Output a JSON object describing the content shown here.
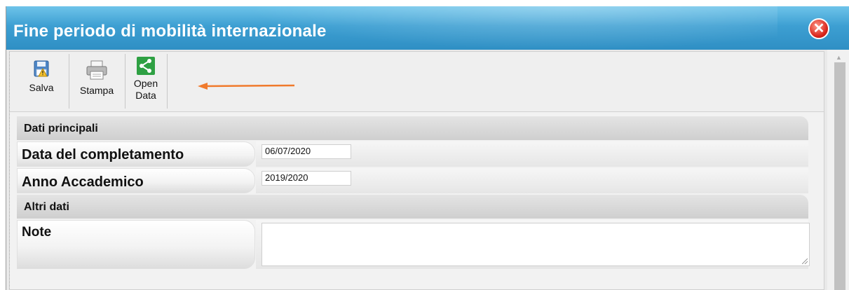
{
  "window": {
    "title": "Fine periodo di mobilità internazionale"
  },
  "toolbar": {
    "save_label": "Salva",
    "print_label": "Stampa",
    "opendata_label_1": "Open",
    "opendata_label_2": "Data"
  },
  "sections": {
    "main": "Dati principali",
    "other": "Altri dati"
  },
  "fields": {
    "completion_date": {
      "label": "Data del completamento",
      "value": "06/07/2020"
    },
    "academic_year": {
      "label": "Anno Accademico",
      "value": "2019/2020"
    },
    "note": {
      "label": "Note",
      "value": ""
    }
  },
  "colors": {
    "titlebar": "#3d9fd2",
    "close": "#d8231a",
    "opendata": "#2ea043",
    "arrow": "#f07a2c"
  }
}
